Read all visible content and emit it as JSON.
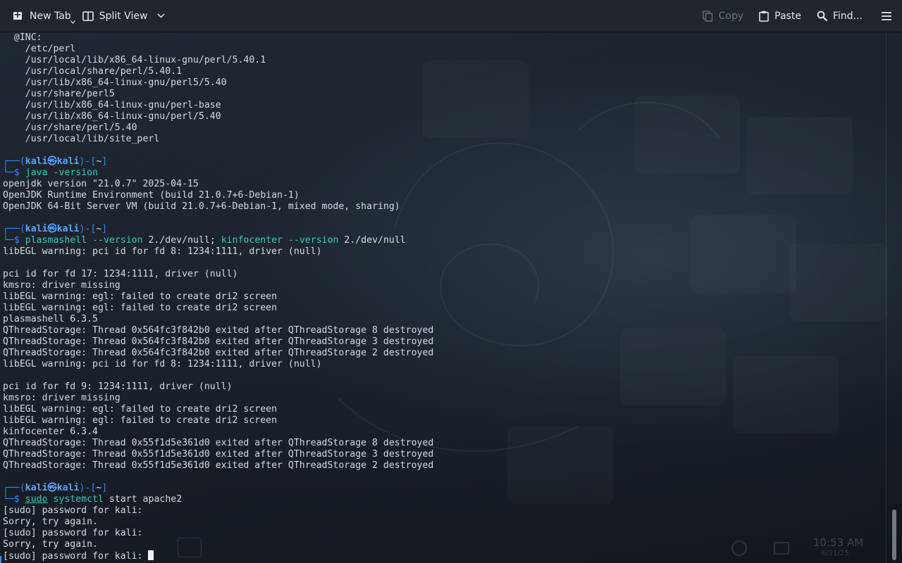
{
  "toolbar": {
    "new_tab": "New Tab",
    "split_view": "Split View",
    "copy": "Copy",
    "paste": "Paste",
    "find": "Find..."
  },
  "terminal": {
    "lines": [
      "  @INC:",
      "    /etc/perl",
      "    /usr/local/lib/x86_64-linux-gnu/perl/5.40.1",
      "    /usr/local/share/perl/5.40.1",
      "    /usr/lib/x86_64-linux-gnu/perl5/5.40",
      "    /usr/share/perl5",
      "    /usr/lib/x86_64-linux-gnu/perl-base",
      "    /usr/lib/x86_64-linux-gnu/perl/5.40",
      "    /usr/share/perl/5.40",
      "    /usr/local/lib/site_perl",
      "",
      "{prompt1}",
      "{cmd1}",
      "openjdk version \"21.0.7\" 2025-04-15",
      "OpenJDK Runtime Environment (build 21.0.7+6-Debian-1)",
      "OpenJDK 64-Bit Server VM (build 21.0.7+6-Debian-1, mixed mode, sharing)",
      "",
      "{prompt2}",
      "{cmd2}",
      "libEGL warning: pci id for fd 8: 1234:1111, driver (null)",
      "",
      "pci id for fd 17: 1234:1111, driver (null)",
      "kmsro: driver missing",
      "libEGL warning: egl: failed to create dri2 screen",
      "libEGL warning: egl: failed to create dri2 screen",
      "plasmashell 6.3.5",
      "QThreadStorage: Thread 0x564fc3f842b0 exited after QThreadStorage 8 destroyed",
      "QThreadStorage: Thread 0x564fc3f842b0 exited after QThreadStorage 3 destroyed",
      "QThreadStorage: Thread 0x564fc3f842b0 exited after QThreadStorage 2 destroyed",
      "libEGL warning: pci id for fd 8: 1234:1111, driver (null)",
      "",
      "pci id for fd 9: 1234:1111, driver (null)",
      "kmsro: driver missing",
      "libEGL warning: egl: failed to create dri2 screen",
      "libEGL warning: egl: failed to create dri2 screen",
      "kinfocenter 6.3.4",
      "QThreadStorage: Thread 0x55f1d5e361d0 exited after QThreadStorage 8 destroyed",
      "QThreadStorage: Thread 0x55f1d5e361d0 exited after QThreadStorage 3 destroyed",
      "QThreadStorage: Thread 0x55f1d5e361d0 exited after QThreadStorage 2 destroyed",
      "",
      "{prompt3}",
      "{cmd3}",
      "[sudo] password for kali:",
      "Sorry, try again.",
      "[sudo] password for kali:",
      "Sorry, try again.",
      "{last}"
    ],
    "prompt": {
      "corner_top": "┌──(",
      "user": "kali",
      "at": "㉿",
      "host": "kali",
      "mid": ")-[",
      "dir": "~",
      "close": "]",
      "corner_bottom": "└─",
      "dollar": "$"
    },
    "commands": [
      [
        {
          "t": "java",
          "c": "cmd"
        },
        {
          "t": " -version",
          "c": "cmd"
        }
      ],
      [
        {
          "t": "plasmashell",
          "c": "cmd"
        },
        {
          "t": " --version ",
          "c": "cmd"
        },
        {
          "t": "2./dev/null",
          "c": "arg"
        },
        {
          "t": "; ",
          "c": "arg"
        },
        {
          "t": "kinfocenter",
          "c": "cmd"
        },
        {
          "t": " --version ",
          "c": "cmd"
        },
        {
          "t": "2./dev/null",
          "c": "arg"
        }
      ],
      [
        {
          "t": "sudo",
          "c": "cmd ul"
        },
        {
          "t": " ",
          "c": "arg"
        },
        {
          "t": "systemctl",
          "c": "cmd"
        },
        {
          "t": " start apache2",
          "c": "arg"
        }
      ]
    ],
    "last_line": "[sudo] password for kali: "
  },
  "desktop_ghost": {
    "clock": "10:53 AM",
    "date": "6/21/25"
  },
  "colors": {
    "prompt_lines": "#2f86ff",
    "prompt_user": "#5aa2ff",
    "command": "#36c9c0",
    "text": "#d6dade",
    "toolbar_bg": "#20262c"
  }
}
